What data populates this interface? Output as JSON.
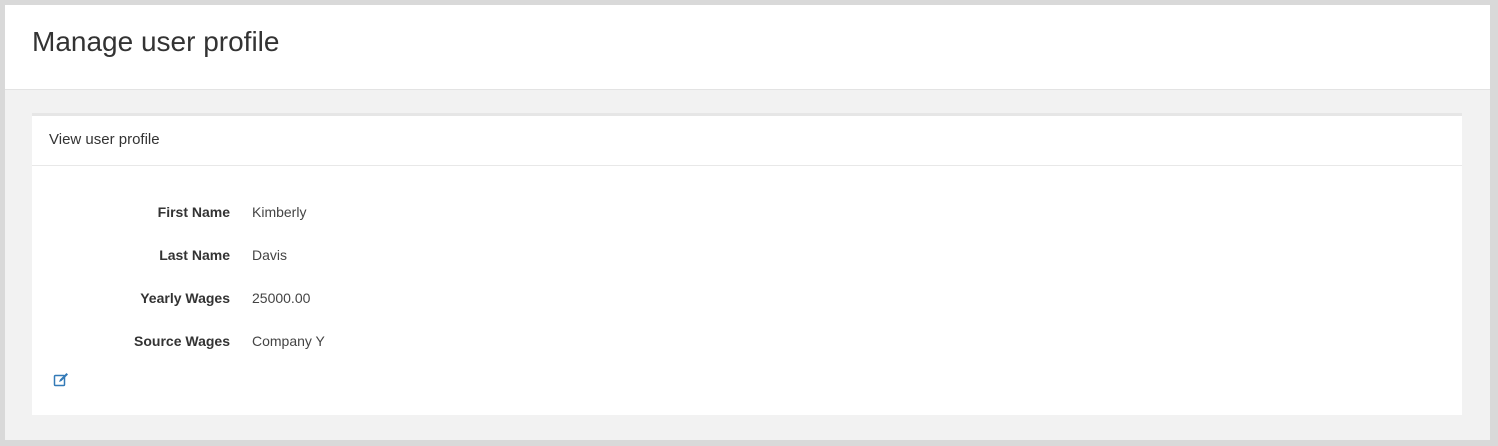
{
  "page": {
    "title": "Manage user profile"
  },
  "panel": {
    "title": "View user profile",
    "fields": [
      {
        "label": "First Name",
        "value": "Kimberly"
      },
      {
        "label": "Last Name",
        "value": "Davis"
      },
      {
        "label": "Yearly Wages",
        "value": "25000.00"
      },
      {
        "label": "Source Wages",
        "value": "Company Y"
      }
    ],
    "edit_icon": "edit-icon"
  },
  "colors": {
    "link": "#337ab7",
    "background": "#f2f2f2"
  }
}
